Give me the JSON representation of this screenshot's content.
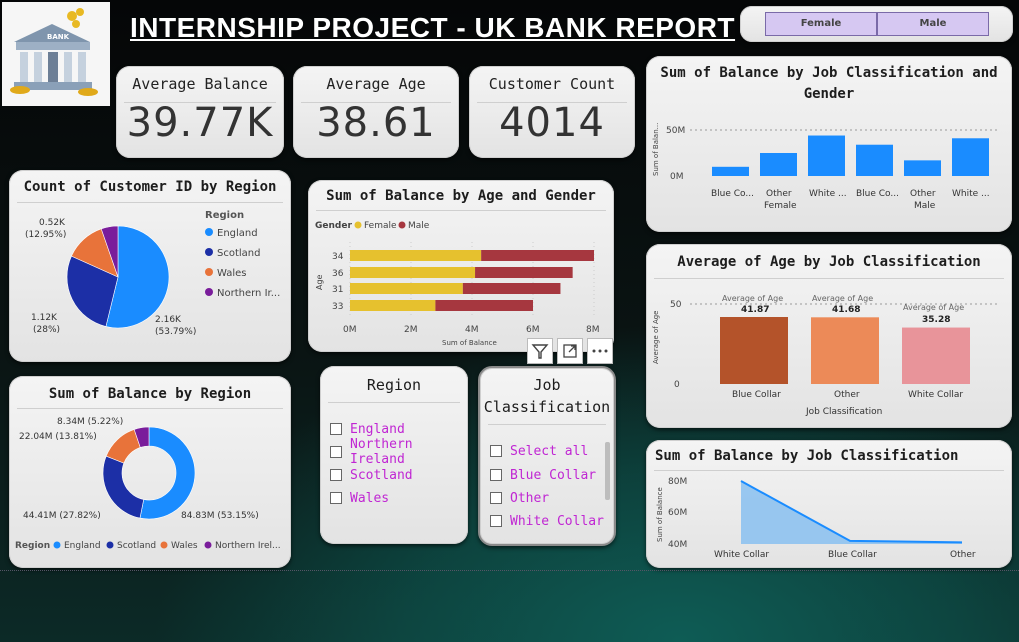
{
  "header": {
    "title": "INTERNSHIP PROJECT - UK BANK REPORT",
    "logo_text": "BANK"
  },
  "gender_slicer": {
    "options": [
      "Female",
      "Male"
    ]
  },
  "kpis": [
    {
      "label": "Average Balance",
      "value": "39.77K"
    },
    {
      "label": "Average Age",
      "value": "38.61"
    },
    {
      "label": "Customer Count",
      "value": "4014"
    }
  ],
  "colors": {
    "england": "#1a8cff",
    "scotland": "#1c2fa6",
    "wales": "#e8733a",
    "northern_ireland": "#7a1d9b",
    "female": "#e6c12e",
    "male": "#a6373f",
    "blue_bar": "#1a8cff",
    "blue_collar": "#b4532a",
    "other": "#ec8a58",
    "white_collar": "#e8949a",
    "area": "#8ec2f0",
    "slicer_text": "#c026d3"
  },
  "count_by_region": {
    "title": "Count of Customer ID by Region",
    "legend_title": "Region",
    "legend": [
      "England",
      "Scotland",
      "Wales",
      "Northern Ir..."
    ],
    "labels": [
      {
        "text": "0.52K",
        "sub": "(12.95%)"
      },
      {
        "text": "1.12K",
        "sub": "(28%)"
      },
      {
        "text": "2.16K",
        "sub": "(53.79%)"
      }
    ]
  },
  "balance_age_gender": {
    "title": "Sum of Balance by Age and Gender",
    "legend_title": "Gender",
    "legend": [
      "Female",
      "Male"
    ],
    "ylabel": "Age",
    "xlabel": "Sum of Balance",
    "xticks": [
      "0M",
      "2M",
      "4M",
      "6M",
      "8M"
    ]
  },
  "balance_by_region": {
    "title": "Sum of Balance by Region",
    "legend_title": "Region",
    "legend": [
      "England",
      "Scotland",
      "Wales",
      "Northern Irel..."
    ],
    "labels": [
      "8.34M (5.22%)",
      "22.04M (13.81%)",
      "44.41M (27.82%)",
      "84.83M (53.15%)"
    ]
  },
  "region_slicer": {
    "title": "Region",
    "items": [
      "England",
      "Northern Ireland",
      "Scotland",
      "Wales"
    ]
  },
  "job_slicer": {
    "title_line1": "Job",
    "title_line2": "Classification",
    "items": [
      "Select all",
      "Blue Collar",
      "Other",
      "White Collar"
    ]
  },
  "balance_job_gender": {
    "title_line1": "Sum of Balance by Job Classification and",
    "title_line2": "Gender",
    "ylabel": "Sum of Balan...",
    "yticks": [
      "50M",
      "0M"
    ],
    "categories": [
      "Blue Co...",
      "Other",
      "White ...",
      "Blue Co...",
      "Other",
      "White ..."
    ],
    "groups": [
      "Female",
      "Male"
    ]
  },
  "avg_age_job": {
    "title": "Average of Age by Job Classification",
    "ylabel": "Average of Age",
    "xlabel": "Job Classification",
    "yticks": [
      "50",
      "0"
    ],
    "label_prefix": "Average of Age",
    "categories": [
      "Blue Collar",
      "Other",
      "White Collar"
    ],
    "value_labels": [
      "41.87",
      "41.68",
      "35.28"
    ]
  },
  "balance_job": {
    "title": "Sum of Balance by Job Classification",
    "ylabel": "Sum of Balance",
    "yticks": [
      "80M",
      "60M",
      "40M"
    ],
    "categories": [
      "White Collar",
      "Blue Collar",
      "Other"
    ]
  },
  "visual_header_icons": [
    "filter-icon",
    "focus-mode-icon",
    "more-options-icon"
  ],
  "chart_data": [
    {
      "type": "pie",
      "title": "Count of Customer ID by Region",
      "categories": [
        "England",
        "Scotland",
        "Wales",
        "Northern Ireland"
      ],
      "values": [
        2160,
        1120,
        520,
        214
      ],
      "legend_position": "right"
    },
    {
      "type": "bar",
      "title": "Sum of Balance by Age and Gender",
      "categories": [
        "34",
        "36",
        "31",
        "33"
      ],
      "series": [
        {
          "name": "Female",
          "values": [
            4.3,
            4.1,
            3.7,
            2.8
          ]
        },
        {
          "name": "Male",
          "values": [
            3.7,
            3.2,
            3.2,
            3.2
          ]
        }
      ],
      "stacked": true,
      "xlim": [
        0,
        8
      ],
      "xlabel": "Sum of Balance",
      "ylabel": "Age"
    },
    {
      "type": "pie",
      "title": "Sum of Balance by Region",
      "donut": true,
      "categories": [
        "England",
        "Scotland",
        "Wales",
        "Northern Ireland"
      ],
      "values": [
        84.83,
        44.41,
        22.04,
        8.34
      ],
      "legend_position": "bottom"
    },
    {
      "type": "bar",
      "title": "Sum of Balance by Job Classification and Gender",
      "categories": [
        "Blue Collar",
        "Other",
        "White Collar",
        "Blue Collar",
        "Other",
        "White Collar"
      ],
      "values": [
        10,
        25,
        44,
        34,
        17,
        41
      ],
      "ylim": [
        0,
        60
      ]
    },
    {
      "type": "bar",
      "title": "Average of Age by Job Classification",
      "categories": [
        "Blue Collar",
        "Other",
        "White Collar"
      ],
      "values": [
        41.87,
        41.68,
        35.28
      ],
      "ylim": [
        0,
        60
      ],
      "xlabel": "Job Classification",
      "ylabel": "Average of Age"
    },
    {
      "type": "area",
      "title": "Sum of Balance by Job Classification",
      "categories": [
        "White Collar",
        "Blue Collar",
        "Other"
      ],
      "values": [
        80,
        42,
        41
      ],
      "ylim": [
        38,
        85
      ],
      "ylabel": "Sum of Balance"
    }
  ]
}
